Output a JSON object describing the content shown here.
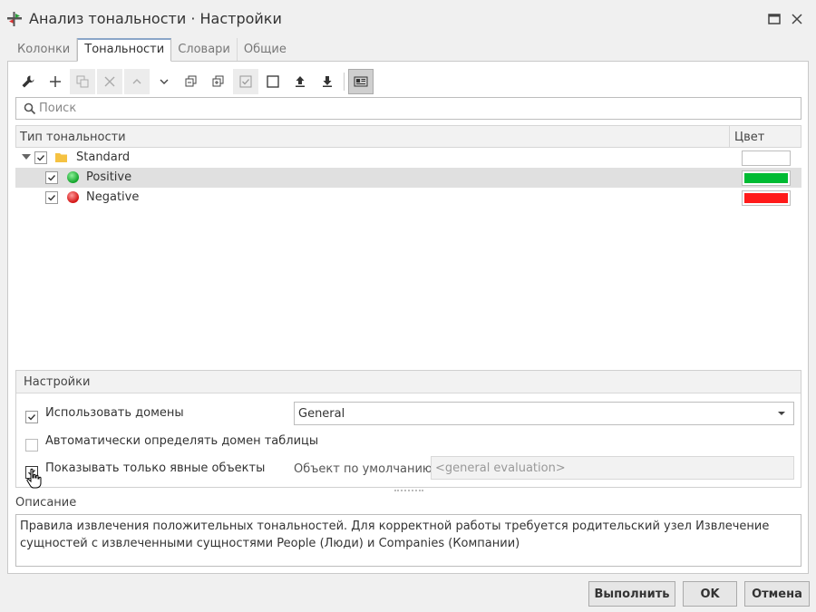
{
  "window": {
    "title": "Анализ тональности · Настройки"
  },
  "tabs": [
    {
      "label": "Колонки"
    },
    {
      "label": "Тональности"
    },
    {
      "label": "Словари"
    },
    {
      "label": "Общие"
    }
  ],
  "toolbar": {
    "icons": [
      "wrench-icon",
      "plus-icon",
      "duplicate-icon",
      "close-icon",
      "chevron-up-icon",
      "chevron-down-icon",
      "collapse-all-icon",
      "expand-all-icon",
      "check-all-icon",
      "uncheck-all-icon",
      "upload-icon",
      "download-icon",
      "preview-icon"
    ]
  },
  "search": {
    "placeholder": "Поиск",
    "value": ""
  },
  "tree": {
    "columns": {
      "type": "Тип тональности",
      "color": "Цвет"
    },
    "rows": [
      {
        "label": "Standard",
        "checked": true,
        "icon": "folder-icon",
        "color": "#ffffff"
      },
      {
        "label": "Positive",
        "checked": true,
        "icon": "green-dot-icon",
        "color": "#00bb33"
      },
      {
        "label": "Negative",
        "checked": true,
        "icon": "red-dot-icon",
        "color": "#ff1a1a"
      }
    ]
  },
  "settings": {
    "header": "Настройки",
    "use_domains": {
      "label": "Использовать домены",
      "checked": true
    },
    "domain": {
      "value": "General"
    },
    "auto_detect": {
      "label": "Автоматически определять домен таблицы",
      "checked": false
    },
    "explicit_only": {
      "label": "Показывать только явные объекты",
      "checked": true
    },
    "default_object": {
      "label": "Объект по умолчанию",
      "placeholder": "<general evaluation>"
    }
  },
  "description": {
    "label": "Описание",
    "text": "Правила извлечения положительных тональностей. Для корректной работы требуется родительский узел Извлечение сущностей с извлеченными сущностями People (Люди) и Companies (Компании)"
  },
  "buttons": {
    "run": "Выполнить",
    "ok": "OK",
    "cancel": "Отмена"
  },
  "colors": {
    "accent_tab": "#8aa6c8",
    "positive": "#00bb33",
    "negative": "#ff1a1a",
    "folder": "#f5c242"
  }
}
